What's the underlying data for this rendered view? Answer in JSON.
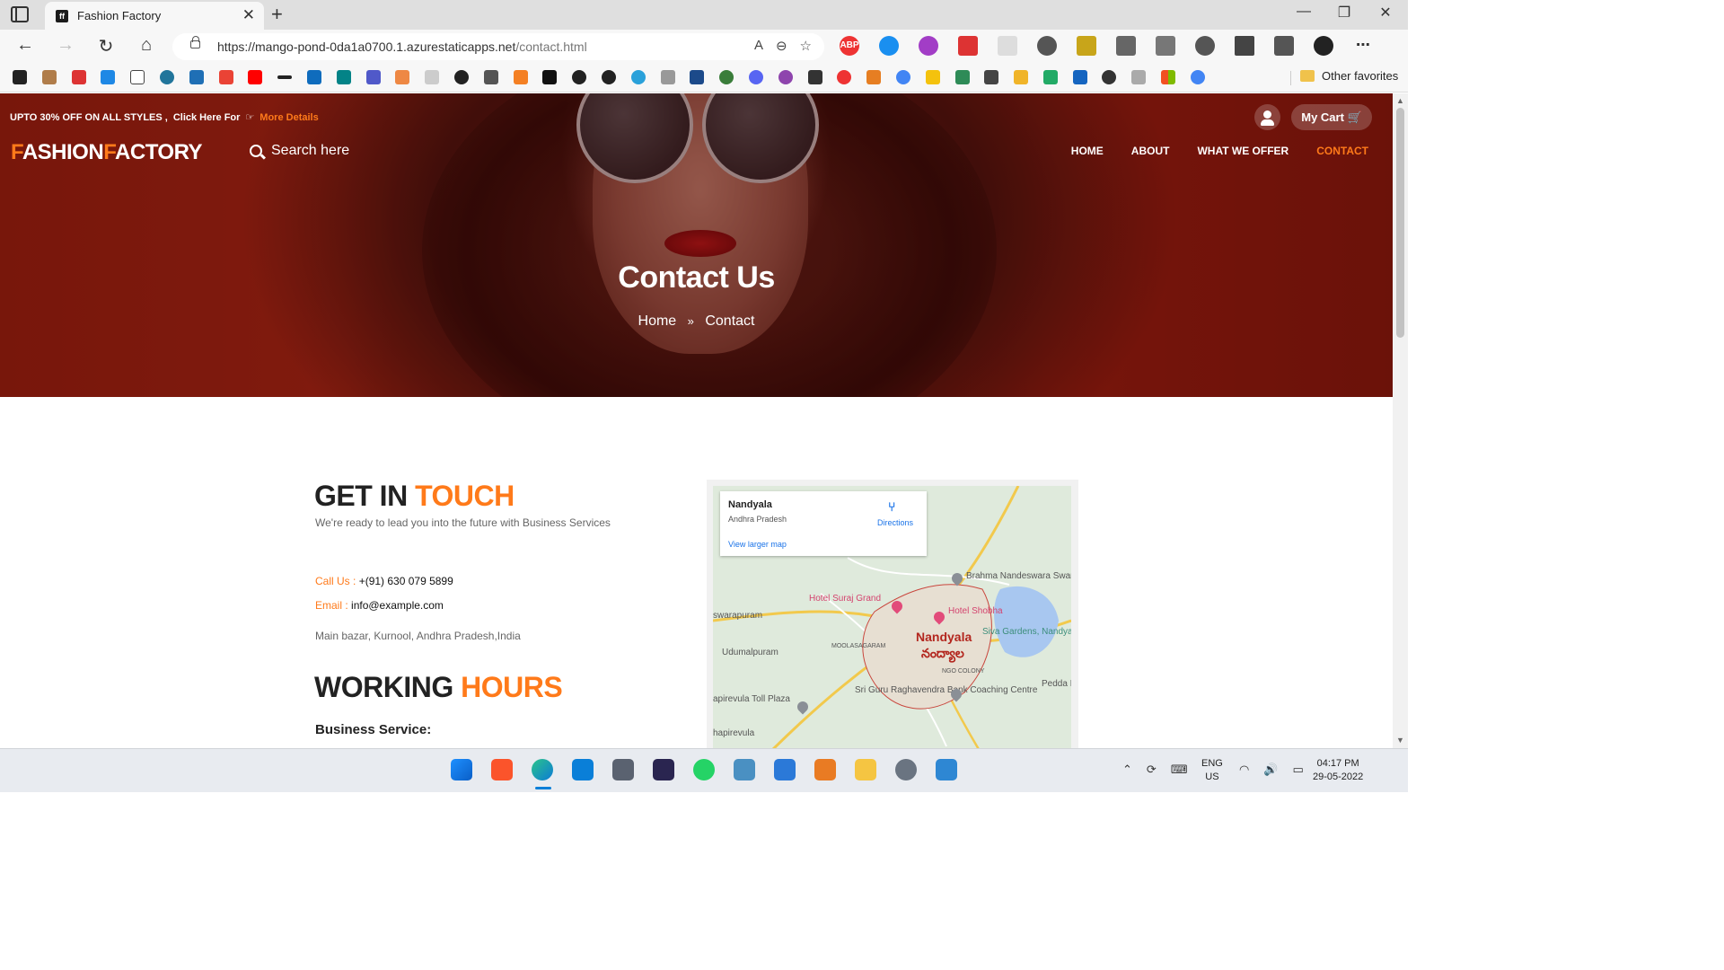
{
  "browser": {
    "tab_title": "Fashion Factory",
    "url_host": "https://mango-pond-0da1a0700.1.azurestaticapps.net",
    "url_path": "/contact.html",
    "other_favorites": "Other favorites"
  },
  "header": {
    "promo_text": "UPTO 30% OFF ON ALL STYLES ,",
    "promo_click": "Click Here For",
    "promo_link": "More Details",
    "cart_label": "My Cart",
    "logo_f1": "F",
    "logo_part1": "ASHION",
    "logo_f2": "F",
    "logo_part2": "ACTORY",
    "search_placeholder": "Search here",
    "menu": [
      "HOME",
      "ABOUT",
      "WHAT WE OFFER",
      "CONTACT"
    ],
    "active_menu": "CONTACT"
  },
  "hero": {
    "title": "Contact Us",
    "breadcrumb_home": "Home",
    "breadcrumb_sep": "»",
    "breadcrumb_current": "Contact"
  },
  "contact": {
    "heading_plain": "GET IN",
    "heading_highlight": "TOUCH",
    "tagline": "We're ready to lead you into the future with Business Services",
    "phone_label": "Call Us :",
    "phone_value": "+(91) 630 079 5899",
    "email_label": "Email :",
    "email_value": "info@example.com",
    "address": "Main bazar, Kurnool, Andhra Pradesh,India",
    "hours_plain": "WORKING",
    "hours_highlight": "HOURS",
    "business_service": "Business Service:"
  },
  "map": {
    "card_city": "Nandyala",
    "card_state": "Andhra Pradesh",
    "directions": "Directions",
    "larger_map": "View larger map",
    "labels": {
      "city": "Nandyala",
      "city_te": "నంద్యాల",
      "hotel1": "Hotel Suraj Grand",
      "hotel2": "Hotel Shobha",
      "temple": "Brahma Nandeswara Swamy Temple",
      "siva": "Siva Gardens, Nandyal Andhra Pradesh, Indi",
      "swara": "swarapuram",
      "udumal": "Udumalpuram",
      "moola": "MOOLASAGARAM",
      "ngo": "NGO COLONY",
      "guru": "Sri Guru Raghavendra Bank Coaching Centre",
      "toll": "apirevula Toll Plaza",
      "pedda": "Pedda Ko",
      "chapir": "hapirevula"
    }
  },
  "taskbar": {
    "lang1": "ENG",
    "lang2": "US",
    "time": "04:17 PM",
    "date": "29-05-2022"
  },
  "colors": {
    "accent": "#ff7a1a",
    "hero_red": "#8e1f0f"
  }
}
